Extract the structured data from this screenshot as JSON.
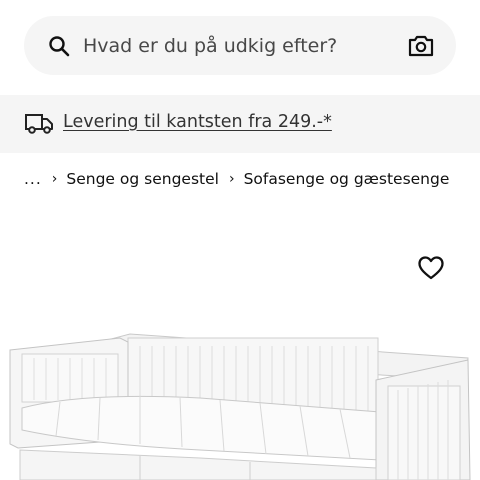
{
  "search": {
    "placeholder": "Hvad er du på udkig efter?",
    "icon": "search-icon",
    "camera_icon": "camera-icon"
  },
  "delivery": {
    "icon": "truck-icon",
    "text": "Levering til kantsten fra 249.-*"
  },
  "breadcrumb": {
    "ellipsis": "...",
    "items": [
      "Senge og sengestel",
      "Sofasenge og gæstesenge"
    ],
    "separator": "›"
  },
  "product": {
    "favorite_icon": "heart-icon",
    "image": "white daybed with mattress"
  }
}
